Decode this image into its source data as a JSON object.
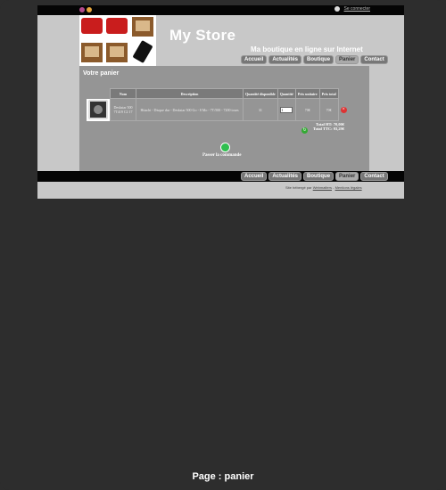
{
  "languages": [
    "English",
    "Français"
  ],
  "login": {
    "label": "Se connecter",
    "icon": "user-icon"
  },
  "header": {
    "brand": "My Store",
    "tagline": "Ma boutique en ligne sur Internet",
    "product_icons": [
      "red-wallet-icon",
      "red-wallet-icon",
      "wooden-box-icon",
      "wooden-box-icon",
      "wooden-box-icon",
      "phone-icon"
    ]
  },
  "nav": [
    "Accueil",
    "Actualités",
    "Boutique",
    "Panier",
    "Contact"
  ],
  "nav_active": "Panier",
  "cart": {
    "title": "Votre panier",
    "columns": [
      "Nom",
      "Description",
      "Quantité disponible",
      "Quantité",
      "Prix unitaire",
      "Prix total"
    ],
    "rows": [
      {
        "name": "Deskstar 500 7T419 C2 17",
        "description": "Hitachi - Disque dur - Deskstar 500 Go - 8 Mo - 7T/500 - 7200 tours",
        "available": "31",
        "quantity": "1",
        "unit_price": "70€",
        "total": "70€"
      }
    ],
    "total_ht": "Total HT: 70,00€",
    "total_ttc": "Total TTC: 93,29€",
    "order_label": "Passer la commande"
  },
  "credits": {
    "text": "Site hébergé par",
    "link1": "Webmafiers",
    "sep": "-",
    "link2": "Mentions légales"
  },
  "caption": "Page : panier",
  "colors": {
    "bar": "#050505",
    "panel": "#959595",
    "page": "#c8c8c8",
    "bg": "#2d2d2d"
  }
}
